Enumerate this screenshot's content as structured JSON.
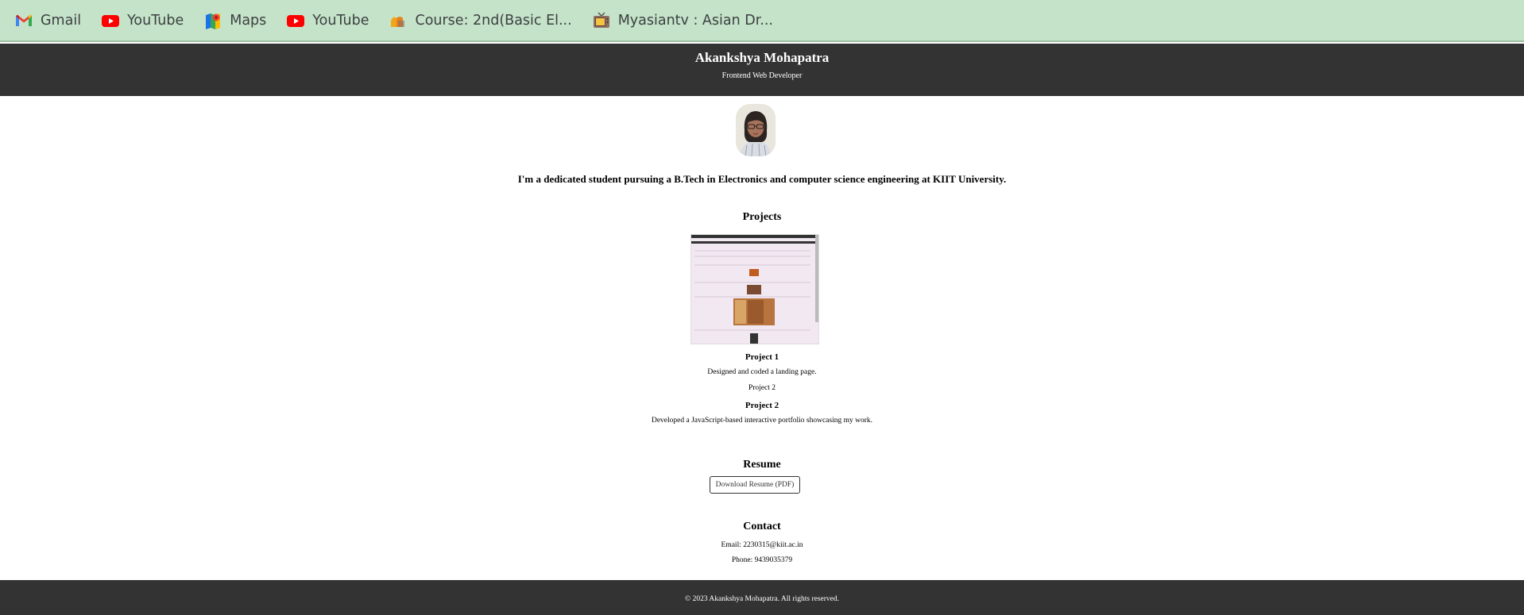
{
  "bookmarks": [
    {
      "label": "Gmail",
      "icon": "gmail-icon"
    },
    {
      "label": "YouTube",
      "icon": "youtube-icon"
    },
    {
      "label": "Maps",
      "icon": "maps-icon"
    },
    {
      "label": "YouTube",
      "icon": "youtube-icon"
    },
    {
      "label": "Course: 2nd(Basic El...",
      "icon": "course-icon"
    },
    {
      "label": "Myasiantv : Asian Dr...",
      "icon": "tv-icon"
    }
  ],
  "header": {
    "name": "Akankshya Mohapatra",
    "role": "Frontend Web Developer"
  },
  "about": {
    "intro": "I'm a dedicated student pursuing a B.Tech in Electronics and computer science engineering at KIIT University."
  },
  "projects": {
    "heading": "Projects",
    "items": [
      {
        "title": "Project 1",
        "description": "Designed and coded a landing page."
      },
      {
        "title": "Project 2",
        "image_alt": "Project 2",
        "description": "Developed a JavaScript-based interactive portfolio showcasing my work."
      }
    ]
  },
  "resume": {
    "heading": "Resume",
    "button_label": "Download Resume (PDF)"
  },
  "contact": {
    "heading": "Contact",
    "email": "Email: 2230315@kiit.ac.in",
    "phone": "Phone: 9439035379"
  },
  "footer": {
    "text": "© 2023 Akankshya Mohapatra. All rights reserved."
  },
  "colors": {
    "bookmarks_bg": "#c5e3c8",
    "header_bg": "#333333",
    "page_bg": "#ffffff"
  }
}
